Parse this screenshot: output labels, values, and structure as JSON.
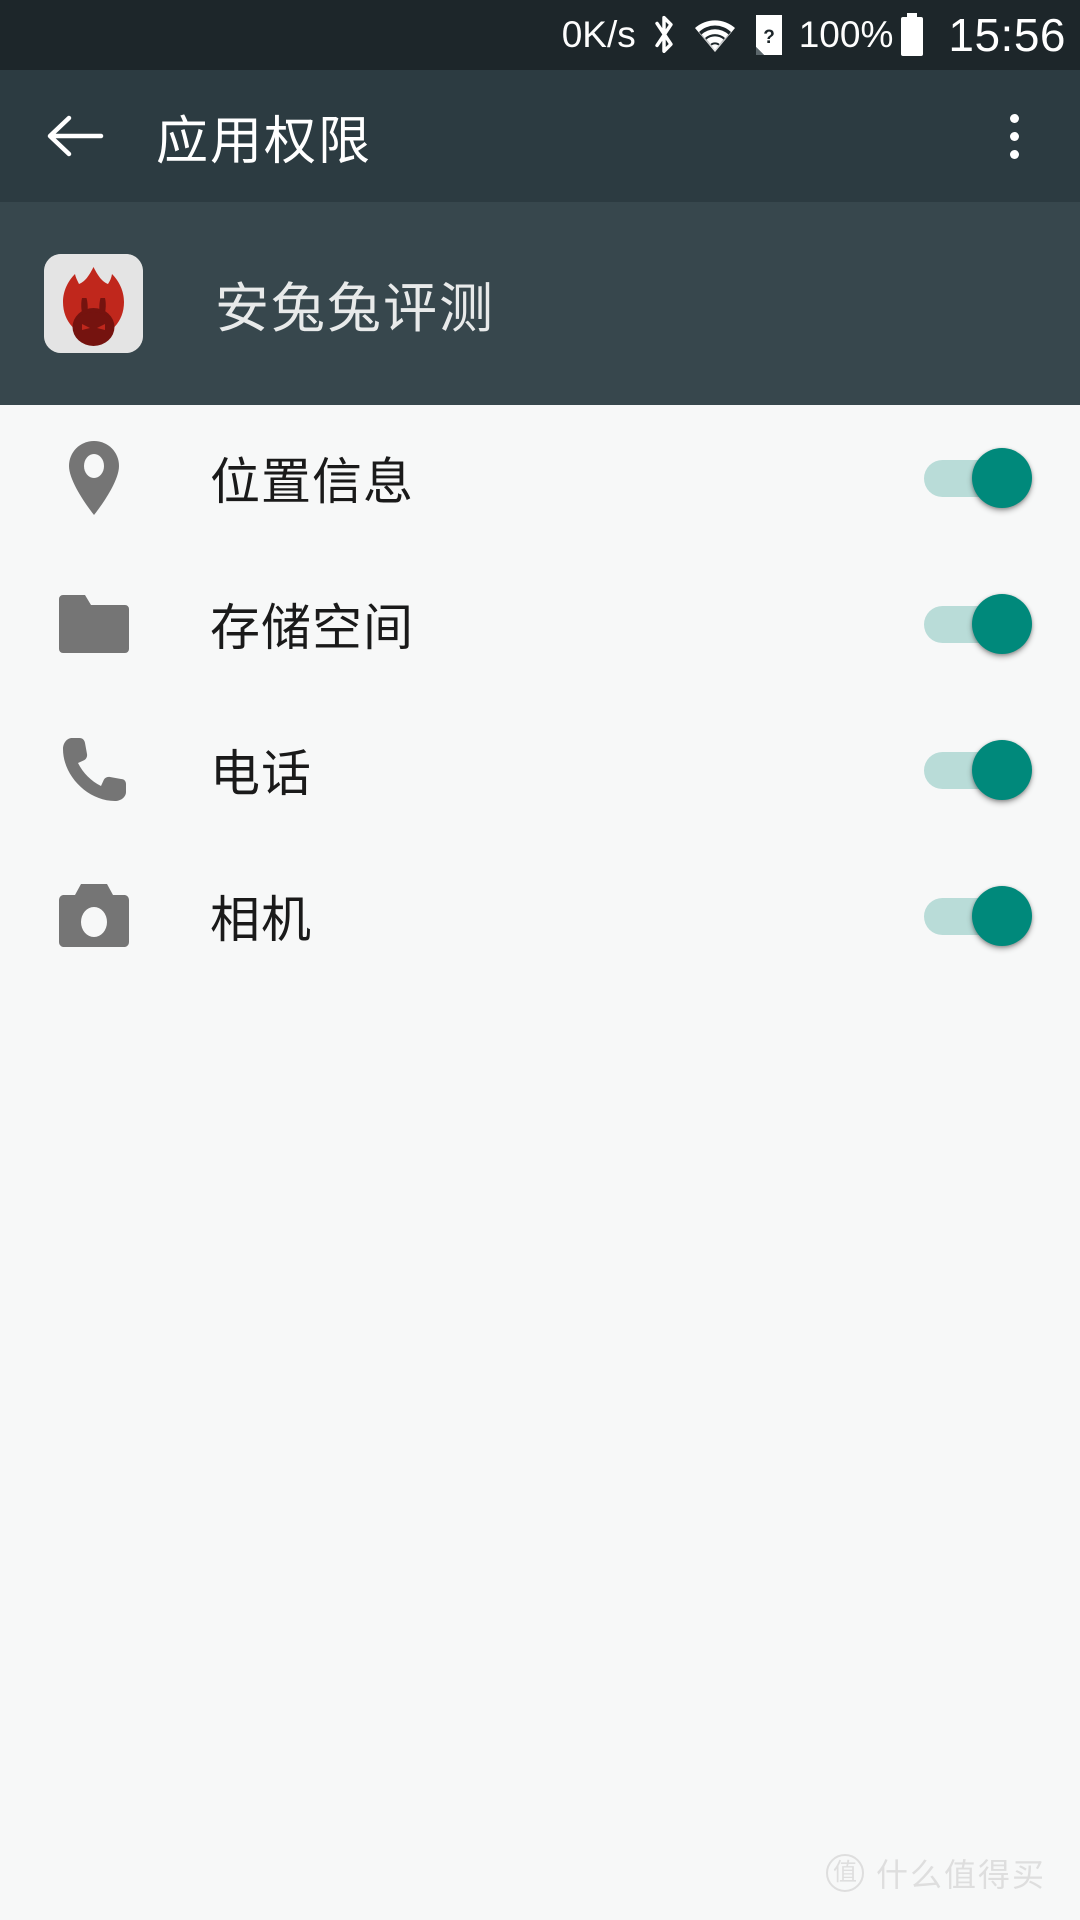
{
  "status_bar": {
    "network_speed": "0K/s",
    "bluetooth_icon": "bluetooth-icon",
    "wifi_icon": "wifi-icon",
    "sim_icon": "sim-card-unknown-icon",
    "battery_percent": "100%",
    "battery_icon": "battery-full-icon",
    "clock": "15:56",
    "background": "#1d262a"
  },
  "app_bar": {
    "back_icon": "back-arrow-icon",
    "title": "应用权限",
    "overflow_icon": "overflow-menu-icon",
    "background": "#2c3b41"
  },
  "app_info": {
    "app_icon": "antutu-app-icon",
    "app_name": "安兔兔评测",
    "background": "#37474d"
  },
  "permissions": {
    "accent_on": "#00897b",
    "track_on": "#b9dcd8",
    "icon_color": "#757575",
    "items": [
      {
        "icon": "location-pin-icon",
        "label": "位置信息",
        "enabled": true,
        "state": "on"
      },
      {
        "icon": "folder-icon",
        "label": "存储空间",
        "enabled": true,
        "state": "on"
      },
      {
        "icon": "phone-icon",
        "label": "电话",
        "enabled": true,
        "state": "on"
      },
      {
        "icon": "camera-icon",
        "label": "相机",
        "enabled": true,
        "state": "on"
      }
    ]
  },
  "watermark": {
    "badge": "值",
    "text": "什么值得买"
  }
}
